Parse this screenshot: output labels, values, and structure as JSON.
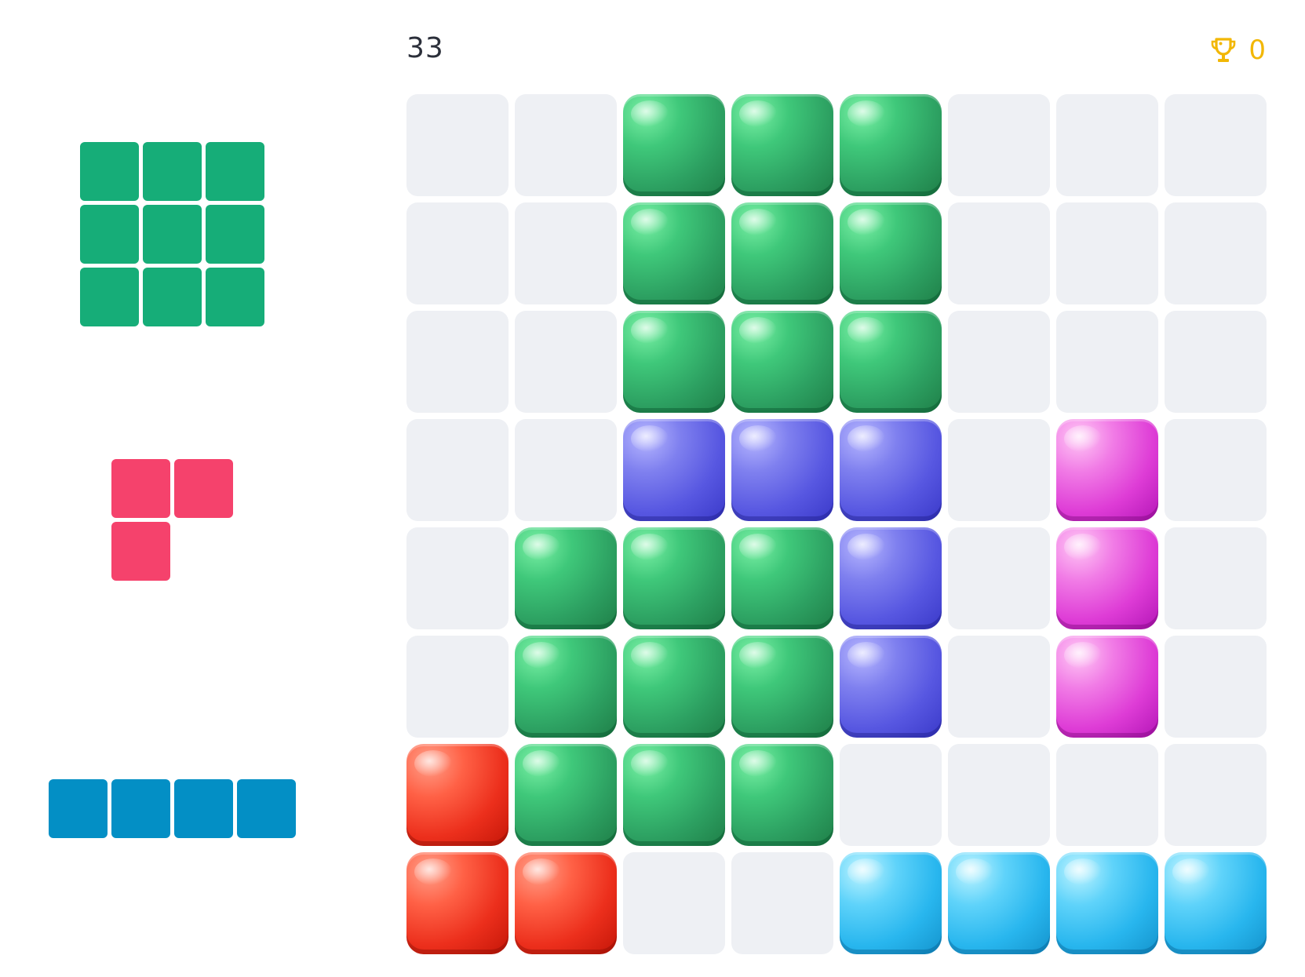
{
  "header": {
    "score": "33",
    "best_score": "0",
    "best_icon": "trophy-icon"
  },
  "colors": {
    "green": "#2da162",
    "purple": "#5757e1",
    "magenta": "#de3cd6",
    "red": "#ec2f1c",
    "cyan": "#28b6ee",
    "empty": "#eef0f4",
    "score_text": "#2b2f3a",
    "trophy": "#f2b705"
  },
  "board": {
    "rows": 8,
    "cols": 8,
    "cells": [
      [
        "",
        "",
        "green",
        "green",
        "green",
        "",
        "",
        ""
      ],
      [
        "",
        "",
        "green",
        "green",
        "green",
        "",
        "",
        ""
      ],
      [
        "",
        "",
        "green",
        "green",
        "green",
        "",
        "",
        ""
      ],
      [
        "",
        "",
        "purple",
        "purple",
        "purple",
        "",
        "magenta",
        ""
      ],
      [
        "",
        "green",
        "green",
        "green",
        "purple",
        "",
        "magenta",
        ""
      ],
      [
        "",
        "green",
        "green",
        "green",
        "purple",
        "",
        "magenta",
        ""
      ],
      [
        "red",
        "green",
        "green",
        "green",
        "",
        "",
        "",
        ""
      ],
      [
        "red",
        "red",
        "",
        "",
        "cyan",
        "cyan",
        "cyan",
        "cyan"
      ]
    ]
  },
  "tray": {
    "pieces": [
      {
        "name": "square-3x3",
        "color": "#16ad78",
        "shape": [
          [
            1,
            1,
            1
          ],
          [
            1,
            1,
            1
          ],
          [
            1,
            1,
            1
          ]
        ]
      },
      {
        "name": "corner-3",
        "color": "#f5426c",
        "shape": [
          [
            1,
            1
          ],
          [
            1,
            0
          ]
        ]
      },
      {
        "name": "line-4",
        "color": "#038fc5",
        "shape": [
          [
            1,
            1,
            1,
            1
          ]
        ]
      }
    ]
  }
}
